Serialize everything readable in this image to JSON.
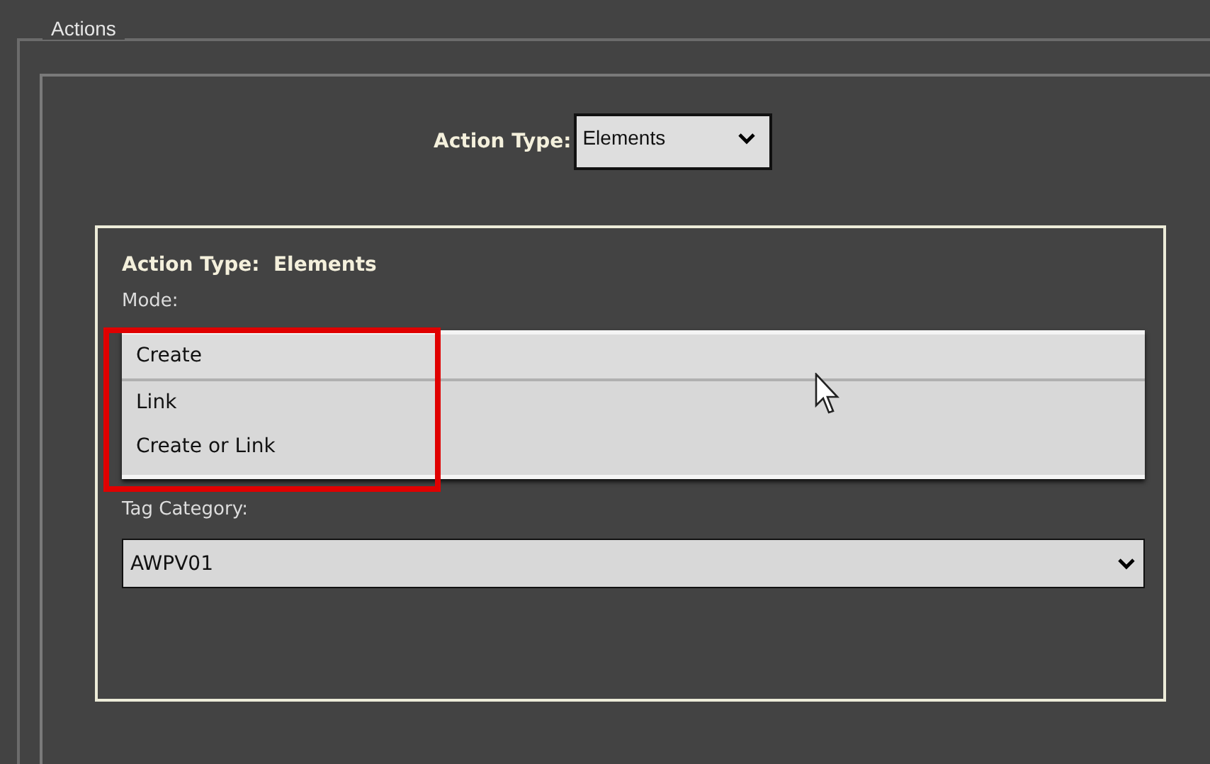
{
  "group": {
    "title": "Actions"
  },
  "action_type": {
    "label": "Action Type:",
    "value": "Elements"
  },
  "panel": {
    "heading_label": "Action Type:",
    "heading_value": "Elements",
    "mode": {
      "label": "Mode:",
      "options": [
        {
          "label": "Create",
          "selected": true
        },
        {
          "label": "Link",
          "selected": false
        },
        {
          "label": "Create or Link",
          "selected": false
        }
      ]
    },
    "tag_category": {
      "label": "Tag Category:",
      "value": "AWPV01"
    }
  }
}
